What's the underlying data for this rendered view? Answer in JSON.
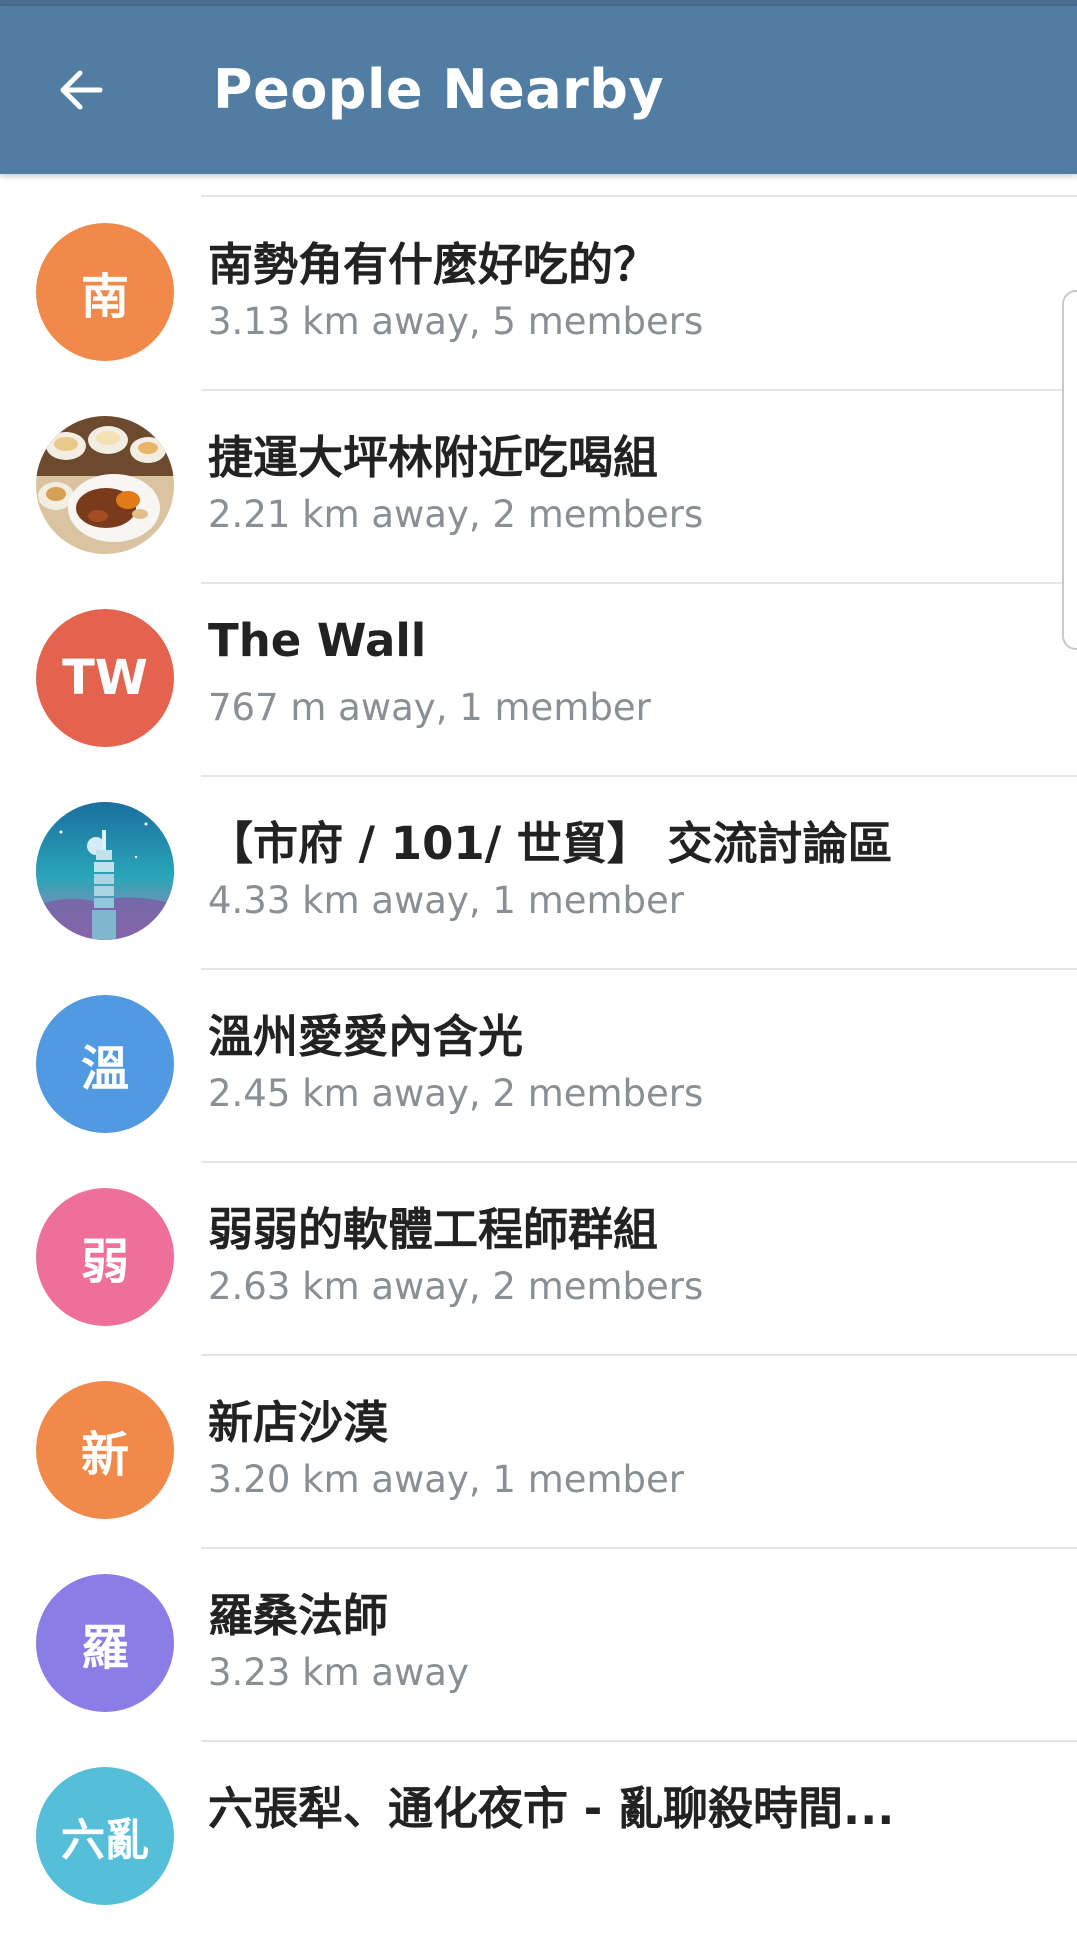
{
  "app_bar": {
    "title": "People Nearby",
    "back_icon": "arrow-left-icon",
    "color": "#527da3"
  },
  "groups": [
    {
      "avatar_text": "南",
      "avatar_color": "#f0894a",
      "title": "南勢角有什麼好吃的？",
      "subtitle": "3.13 km away, 5 members"
    },
    {
      "avatar_text": "",
      "avatar_image": "dim-sum-food-photo",
      "title": "捷運大坪林附近吃喝組",
      "subtitle": "2.21 km away, 2 members"
    },
    {
      "avatar_text": "TW",
      "avatar_color": "#e3634f",
      "title": "The Wall",
      "subtitle": "767 m away, 1 member"
    },
    {
      "avatar_text": "",
      "avatar_image": "taipei-101-night-illustration",
      "title": "【市府 / 101/ 世貿】 交流討論區",
      "subtitle": "4.33 km away, 1 member"
    },
    {
      "avatar_text": "溫",
      "avatar_color": "#5199e0",
      "title": "溫州愛愛內含光",
      "subtitle": "2.45 km away, 2 members"
    },
    {
      "avatar_text": "弱",
      "avatar_color": "#ee6f9a",
      "title": "弱弱的軟體工程師群組",
      "subtitle": "2.63 km away, 2 members"
    },
    {
      "avatar_text": "新",
      "avatar_color": "#f0894a",
      "title": "新店沙漠",
      "subtitle": "3.20 km away, 1 member"
    },
    {
      "avatar_text": "羅",
      "avatar_color": "#8c7ce8",
      "title": "羅桑法師",
      "subtitle": "3.23 km away"
    },
    {
      "avatar_text": "六亂",
      "avatar_color": "#55bfd9",
      "title": "六張犁、通化夜市 - 亂聊殺時間...",
      "subtitle": ""
    }
  ]
}
